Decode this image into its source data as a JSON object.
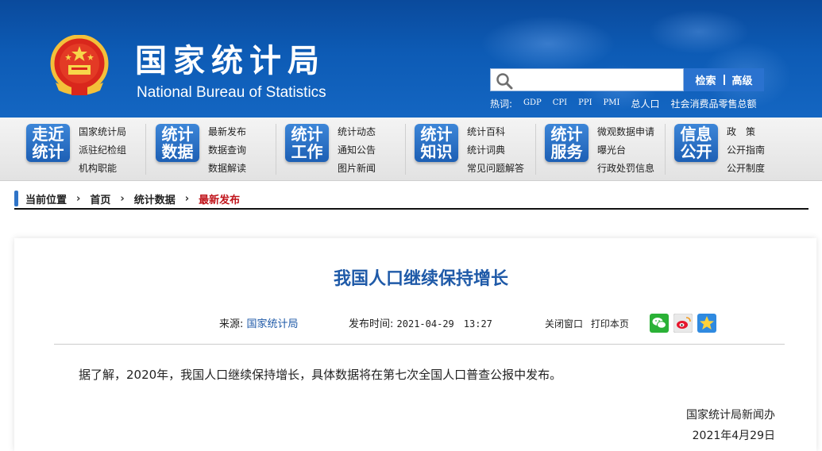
{
  "header": {
    "title": "国家统计局",
    "subtitle": "National Bureau of Statistics",
    "search": {
      "placeholder": "",
      "button_label": "检索",
      "advanced_label": "高级"
    },
    "quicklinks": [
      "热词:",
      "GDP",
      "CPI",
      "PPI",
      "PMI",
      "总人口",
      "社会消费品零售总额"
    ]
  },
  "nav": {
    "groups": [
      {
        "badge": "走近统计",
        "badge_l1": "走近",
        "badge_l2": "统计",
        "links": [
          "国家统计局",
          "派驻纪检组",
          "机构职能"
        ]
      },
      {
        "badge": "统计数据",
        "badge_l1": "统计",
        "badge_l2": "数据",
        "links": [
          "最新发布",
          "数据查询",
          "数据解读"
        ]
      },
      {
        "badge": "统计工作",
        "badge_l1": "统计",
        "badge_l2": "工作",
        "links": [
          "统计动态",
          "通知公告",
          "图片新闻"
        ]
      },
      {
        "badge": "统计知识",
        "badge_l1": "统计",
        "badge_l2": "知识",
        "links": [
          "统计百科",
          "统计词典",
          "常见问题解答"
        ]
      },
      {
        "badge": "统计服务",
        "badge_l1": "统计",
        "badge_l2": "服务",
        "links": [
          "微观数据申请",
          "曝光台",
          "行政处罚信息"
        ]
      },
      {
        "badge": "信息公开",
        "badge_l1": "信息",
        "badge_l2": "公开",
        "links": [
          "政　策",
          "公开指南",
          "公开制度"
        ]
      }
    ]
  },
  "breadcrumb": {
    "label": "当前位置",
    "items": [
      "首页",
      "统计数据",
      "最新发布"
    ]
  },
  "article": {
    "title": "我国人口继续保持增长",
    "source_label": "来源:",
    "source": "国家统计局",
    "time_label": "发布时间:",
    "time": "2021-04-29　13:27",
    "close_label": "关闭窗口",
    "print_label": "打印本页",
    "share_icons": [
      "wechat-icon",
      "weibo-icon",
      "qzone-icon"
    ],
    "body": "据了解，2020年，我国人口继续保持增长，具体数据将在第七次全国人口普查公报中发布。",
    "signature_org": "国家统计局新闻办",
    "signature_date": "2021年4月29日"
  },
  "colors": {
    "header_blue": "#0d5bb5",
    "title_blue": "#1f5aa8",
    "crumb_red": "#c0141b"
  }
}
